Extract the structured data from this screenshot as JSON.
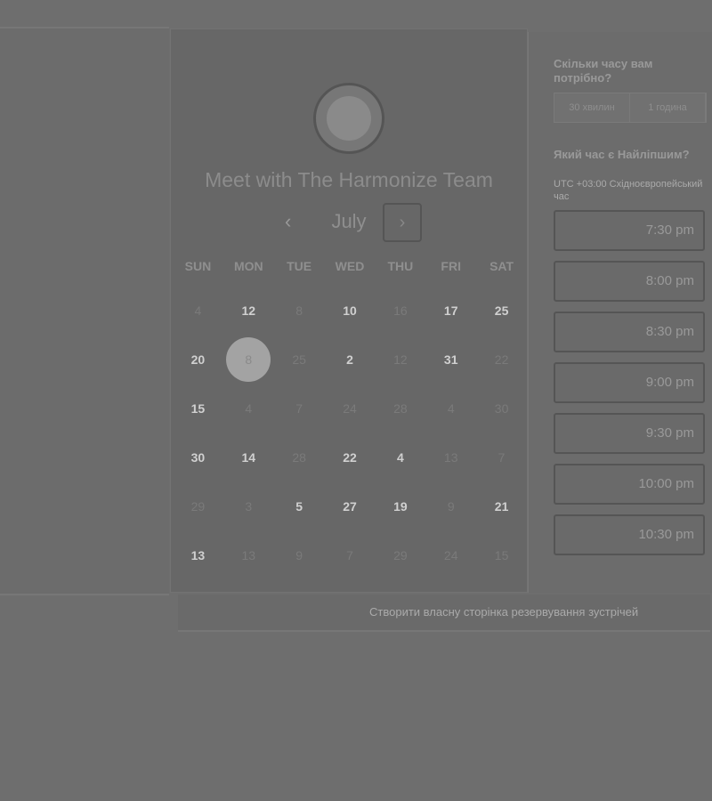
{
  "calendar": {
    "title": "Meet with The Harmonize Team",
    "month": "July",
    "prev": "‹",
    "next": "›",
    "weekdays": [
      "SUN",
      "MON",
      "TUE",
      "WED",
      "THU",
      "FRI",
      "SAT"
    ],
    "days": [
      [
        {
          "d": "4",
          "s": "dim"
        },
        {
          "d": "12",
          "s": "on"
        },
        {
          "d": "8",
          "s": "dim"
        },
        {
          "d": "10",
          "s": "on"
        },
        {
          "d": "16",
          "s": "dim"
        },
        {
          "d": "17",
          "s": "on"
        },
        {
          "d": "25",
          "s": "on"
        }
      ],
      [
        {
          "d": "20",
          "s": "on"
        },
        {
          "d": "8",
          "s": "sel"
        },
        {
          "d": "25",
          "s": "dim"
        },
        {
          "d": "2",
          "s": "on"
        },
        {
          "d": "12",
          "s": "dim"
        },
        {
          "d": "31",
          "s": "on"
        },
        {
          "d": "22",
          "s": "dim"
        }
      ],
      [
        {
          "d": "15",
          "s": "on"
        },
        {
          "d": "4",
          "s": "dim"
        },
        {
          "d": "7",
          "s": "dim"
        },
        {
          "d": "24",
          "s": "dim"
        },
        {
          "d": "28",
          "s": "dim"
        },
        {
          "d": "4",
          "s": "dim"
        },
        {
          "d": "30",
          "s": "dim"
        }
      ],
      [
        {
          "d": "30",
          "s": "on"
        },
        {
          "d": "14",
          "s": "on"
        },
        {
          "d": "28",
          "s": "dim"
        },
        {
          "d": "22",
          "s": "on"
        },
        {
          "d": "4",
          "s": "on"
        },
        {
          "d": "13",
          "s": "dim"
        },
        {
          "d": "7",
          "s": "dim"
        }
      ],
      [
        {
          "d": "29",
          "s": "dim"
        },
        {
          "d": "3",
          "s": "dim"
        },
        {
          "d": "5",
          "s": "on"
        },
        {
          "d": "27",
          "s": "on"
        },
        {
          "d": "19",
          "s": "on"
        },
        {
          "d": "9",
          "s": "dim"
        },
        {
          "d": "21",
          "s": "on"
        }
      ],
      [
        {
          "d": "13",
          "s": "on"
        },
        {
          "d": "13",
          "s": "dim"
        },
        {
          "d": "9",
          "s": "dim"
        },
        {
          "d": "7",
          "s": "dim"
        },
        {
          "d": "29",
          "s": "dim"
        },
        {
          "d": "24",
          "s": "dim"
        },
        {
          "d": "15",
          "s": "dim"
        }
      ]
    ]
  },
  "right": {
    "duration_q": "Скільки часу вам потрібно?",
    "durations": [
      "30 хвилин",
      "1 година"
    ],
    "time_q": "Який час є Найліпшим?",
    "timezone": "UTC +03:00 Східноєвропейський час",
    "slots": [
      "7:30 pm",
      "8:00 pm",
      "8:30 pm",
      "9:00 pm",
      "9:30 pm",
      "10:00 pm",
      "10:30 pm"
    ]
  },
  "footer": {
    "link": "Створити власну сторінка резервування зустрічей"
  }
}
